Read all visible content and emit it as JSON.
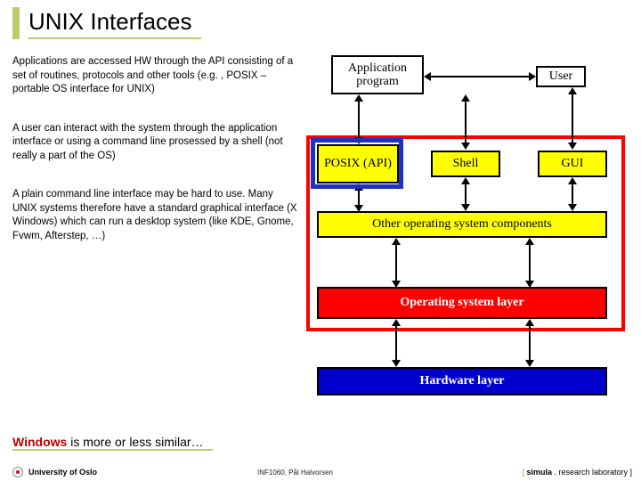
{
  "title": "UNIX Interfaces",
  "paragraphs": {
    "p1": "Applications are accessed HW through the API consisting of a set of routines, protocols and other tools (e.g. , POSIX – portable OS interface for UNIX)",
    "p2": "A user can interact with the system through the application interface or using a command line prosessed by a shell (not really a part of the OS)",
    "p3": "A plain command line interface may be hard to use. Many UNIX systems therefore have a standard graphical interface (X Windows) which can run a desktop system (like KDE, Gnome, Fvwm, Afterstep, …)"
  },
  "windows": {
    "highlight": "Windows",
    "rest": " is more or less similar…"
  },
  "diagram": {
    "app": "Application program",
    "user": "User",
    "posix": "POSIX (API)",
    "shell": "Shell",
    "gui": "GUI",
    "other": "Other operating system components",
    "os": "Operating system layer",
    "hw": "Hardware layer"
  },
  "footer": {
    "uio": "University of Oslo",
    "course": "INF1060, Pål Halvorsen",
    "simula_open": "[ ",
    "simula_bold": "simula",
    "simula_rest": " . research laboratory ]"
  }
}
